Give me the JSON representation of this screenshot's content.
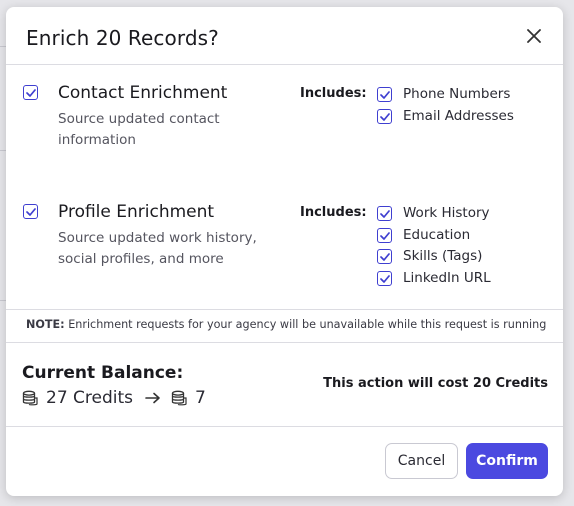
{
  "dialog": {
    "title": "Enrich 20 Records?"
  },
  "sections": [
    {
      "title": "Contact Enrichment",
      "description": "Source updated contact information",
      "includes_label": "Includes:",
      "checked": true,
      "options": [
        {
          "label": "Phone Numbers",
          "checked": true
        },
        {
          "label": "Email Addresses",
          "checked": true
        }
      ]
    },
    {
      "title": "Profile Enrichment",
      "description": "Source updated work history, social profiles, and more",
      "includes_label": "Includes:",
      "checked": true,
      "options": [
        {
          "label": "Work History",
          "checked": true
        },
        {
          "label": "Education",
          "checked": true
        },
        {
          "label": "Skills (Tags)",
          "checked": true
        },
        {
          "label": "LinkedIn URL",
          "checked": true
        }
      ]
    }
  ],
  "note": {
    "prefix": "NOTE:",
    "text": "Enrichment requests for your agency will be unavailable while this request is running"
  },
  "balance": {
    "label": "Current Balance:",
    "current": "27 Credits",
    "after": "7",
    "cost_text": "This action will cost 20 Credits"
  },
  "buttons": {
    "cancel": "Cancel",
    "confirm": "Confirm"
  },
  "colors": {
    "accent": "#4b49e0",
    "checkbox": "#3f3fd0"
  },
  "icons": {
    "close": "close-icon",
    "coins": "coins-icon",
    "arrow": "arrow-right-icon",
    "check": "check-icon"
  }
}
